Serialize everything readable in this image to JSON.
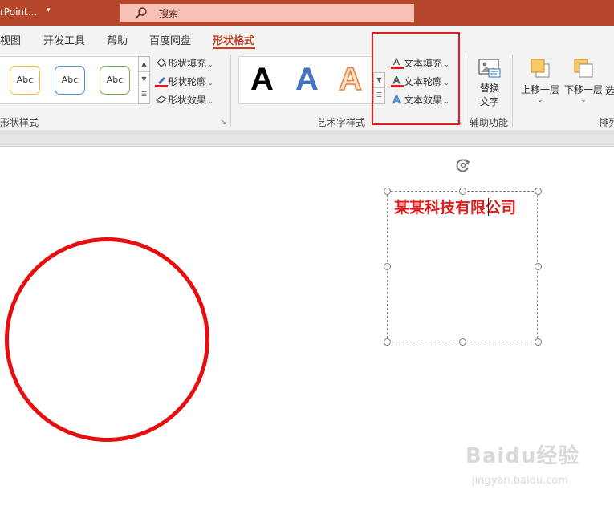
{
  "titlebar": {
    "app_title": "rPoint...",
    "caret": "▾",
    "search_placeholder": "搜索"
  },
  "tabs": [
    {
      "label": "视图"
    },
    {
      "label": "开发工具"
    },
    {
      "label": "帮助"
    },
    {
      "label": "百度网盘"
    },
    {
      "label": "形状格式",
      "active": true
    }
  ],
  "ribbon": {
    "shape_styles": {
      "thumb_labels": [
        "Abc",
        "Abc",
        "Abc"
      ],
      "fill_label": "形状填充",
      "outline_label": "形状轮廓",
      "effects_label": "形状效果",
      "group_label": "形状样式"
    },
    "wordart_styles": {
      "samples": [
        "A",
        "A",
        "A"
      ],
      "text_fill_label": "文本填充",
      "text_outline_label": "文本轮廓",
      "text_effects_label": "文本效果",
      "group_label": "艺术字样式"
    },
    "accessibility": {
      "alt_text_line1": "替换",
      "alt_text_line2": "文字",
      "group_label": "辅助功能"
    },
    "arrange": {
      "bring_forward_label": "上移一层",
      "send_backward_label": "下移一层",
      "select_label": "选",
      "group_label": "排列"
    }
  },
  "slide": {
    "textbox_text": "某某科技有限公司"
  },
  "watermark": {
    "main": "Baidu经验",
    "sub": "jingyan.baidu.com"
  },
  "colors": {
    "titlebar": "#b7472a",
    "accent": "#b7472a",
    "highlight": "#e01b1b",
    "circle_stroke": "#e60f0f",
    "text_red": "#e01b1b"
  }
}
